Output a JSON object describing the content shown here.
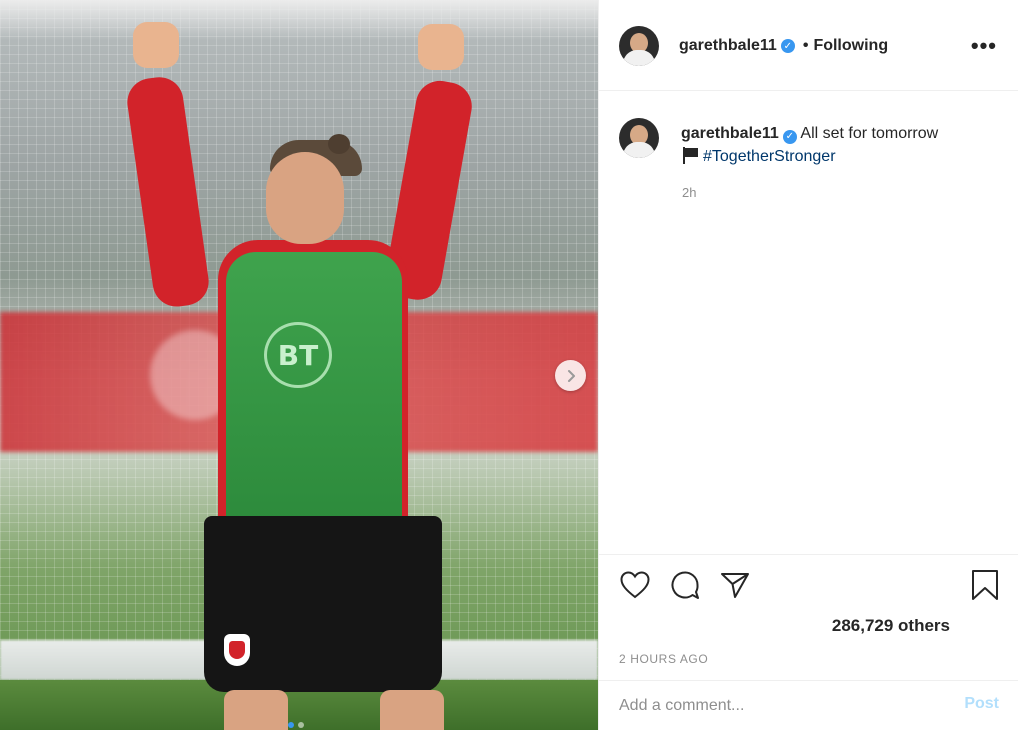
{
  "post": {
    "username": "garethbale11",
    "verified": true,
    "follow_state": "Following",
    "more_icon": "more-horizontal-icon",
    "caption": {
      "text": "All set for tomorrow",
      "emoji_icon": "black-flag-icon",
      "hashtag": "#TogetherStronger",
      "time_ago": "2h"
    },
    "likes_text": "286,729 others",
    "posted_ago": "2 HOURS AGO",
    "comment": {
      "placeholder": "Add a comment...",
      "post_label": "Post"
    },
    "actions": [
      "heart-icon",
      "comment-icon",
      "share-icon",
      "bookmark-icon"
    ]
  },
  "media": {
    "bib_logo": "BT",
    "carousel": {
      "total": 2,
      "current": 1
    },
    "next_icon": "chevron-right-icon"
  },
  "colors": {
    "accent": "#3897f0",
    "hashtag": "#00376b",
    "muted": "#8e8e8e",
    "post_disabled": "#b2dffc"
  }
}
